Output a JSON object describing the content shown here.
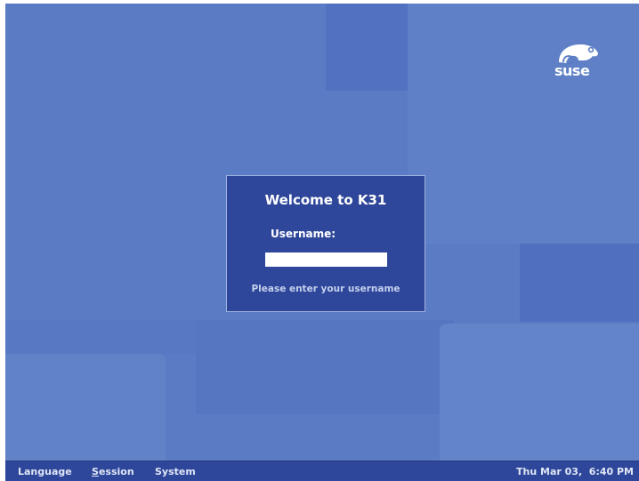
{
  "branding": {
    "logo_text": "suse"
  },
  "login": {
    "welcome": "Welcome to K31",
    "username_label": "Username:",
    "username_value": "",
    "hint": "Please enter your username"
  },
  "taskbar": {
    "menu": [
      {
        "label": "Language",
        "mnemonic": ""
      },
      {
        "label": "Session",
        "mnemonic": "S",
        "rest": "ession"
      },
      {
        "label": "System",
        "mnemonic": ""
      }
    ],
    "clock": "Thu Mar 03,  6:40 PM"
  },
  "colors": {
    "desktop": "#5a7cc4",
    "dialog": "#2f479a",
    "taskbar": "#2f479a"
  }
}
